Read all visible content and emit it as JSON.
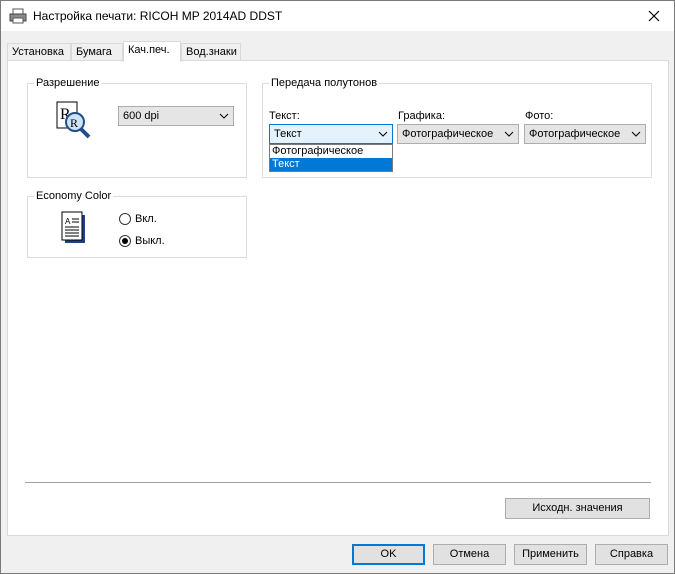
{
  "window": {
    "title": "Настройка печати: RICOH MP 2014AD DDST"
  },
  "tabs": [
    {
      "label": "Установка"
    },
    {
      "label": "Бумага"
    },
    {
      "label": "Кач.печ."
    },
    {
      "label": "Вод.знаки"
    }
  ],
  "resolution": {
    "group_label": "Разрешение",
    "value": "600 dpi"
  },
  "economy": {
    "group_label": "Economy Color",
    "on_label": "Вкл.",
    "off_label": "Выкл.",
    "selected": "off"
  },
  "halftone": {
    "group_label": "Передача полутонов",
    "text": {
      "label": "Текст:",
      "value": "Текст",
      "options": [
        "Фотографическое",
        "Текст"
      ]
    },
    "graphics": {
      "label": "Графика:",
      "value": "Фотографическое"
    },
    "photo": {
      "label": "Фото:",
      "value": "Фотографическое"
    }
  },
  "buttons": {
    "defaults": "Исходн. значения",
    "ok": "OK",
    "cancel": "Отмена",
    "apply": "Применить",
    "help": "Справка"
  },
  "colors": {
    "accent": "#0078d7"
  }
}
